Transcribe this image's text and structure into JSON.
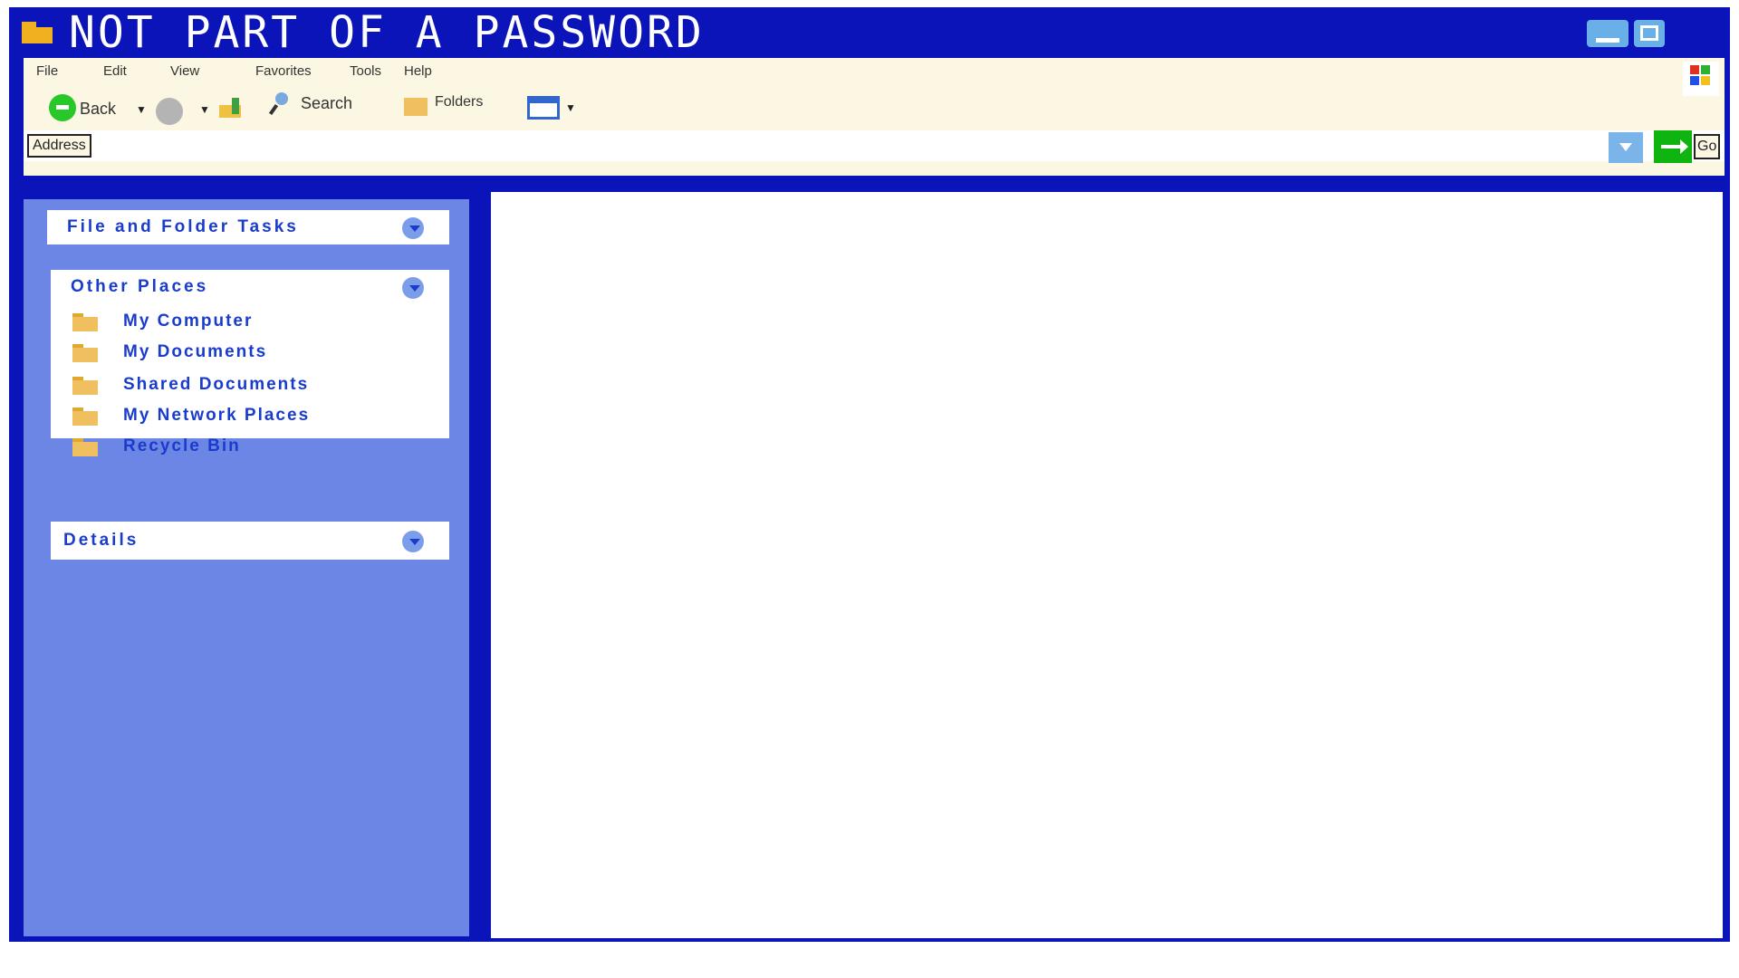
{
  "window": {
    "title": "NOT PART OF A PASSWORD",
    "colors": {
      "frame": "#0a14b8",
      "titlebar_text": "#ffffff",
      "toolbar_bg": "#fbf7e3",
      "taskpane_bg": "#6c86e6",
      "link_text": "#1a3ccc",
      "go_button": "#10b410"
    },
    "controls": {
      "minimize": "minimize-icon",
      "maximize": "maximize-icon"
    }
  },
  "menu": {
    "items": [
      "File",
      "Edit",
      "View",
      "Favorites",
      "Tools",
      "Help"
    ]
  },
  "toolbar": {
    "back_label": "Back",
    "search_label": "Search",
    "folders_label": "Folders",
    "icons": [
      "back-arrow-icon",
      "forward-arrow-icon",
      "up-folder-icon",
      "search-icon",
      "folders-icon",
      "views-icon"
    ]
  },
  "address": {
    "label": "Address",
    "value": "",
    "go_label": "Go"
  },
  "taskpane": {
    "panels": [
      {
        "title": "File and Folder Tasks",
        "expanded": false,
        "items": []
      },
      {
        "title": "Other Places",
        "expanded": true,
        "items": [
          "My Computer",
          "My Documents",
          "Shared Documents",
          "My Network Places",
          "Recycle Bin"
        ]
      },
      {
        "title": "Details",
        "expanded": false,
        "items": []
      }
    ]
  }
}
